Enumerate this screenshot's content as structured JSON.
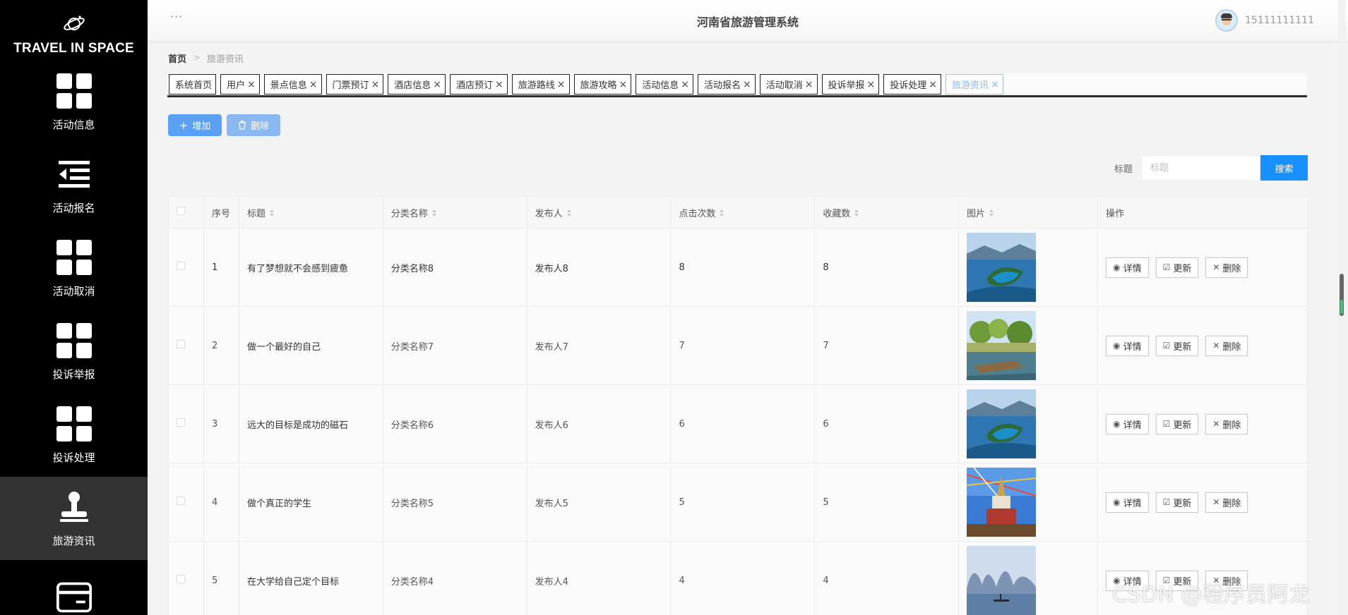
{
  "sidebar": {
    "brand": "TRAVEL IN SPACE",
    "items": [
      {
        "label": "活动信息",
        "icon": "grid-icon"
      },
      {
        "label": "活动报名",
        "icon": "list-indent-icon"
      },
      {
        "label": "活动取消",
        "icon": "grid-icon"
      },
      {
        "label": "投诉举报",
        "icon": "grid-icon"
      },
      {
        "label": "投诉处理",
        "icon": "grid-icon"
      },
      {
        "label": "旅游资讯",
        "icon": "stamp-icon",
        "active": true
      },
      {
        "label": "",
        "icon": "card-icon"
      }
    ]
  },
  "header": {
    "title": "河南省旅游管理系统",
    "username": "15111111111"
  },
  "breadcrumb": {
    "home": "首页",
    "separator": ">",
    "current": "旅游资讯"
  },
  "tabs": [
    {
      "label": "系统首页",
      "closable": false
    },
    {
      "label": "用户",
      "closable": true
    },
    {
      "label": "景点信息",
      "closable": true
    },
    {
      "label": "门票预订",
      "closable": true
    },
    {
      "label": "酒店信息",
      "closable": true
    },
    {
      "label": "酒店预订",
      "closable": true
    },
    {
      "label": "旅游路线",
      "closable": true
    },
    {
      "label": "旅游攻略",
      "closable": true
    },
    {
      "label": "活动信息",
      "closable": true
    },
    {
      "label": "活动报名",
      "closable": true
    },
    {
      "label": "活动取消",
      "closable": true
    },
    {
      "label": "投诉举报",
      "closable": true
    },
    {
      "label": "投诉处理",
      "closable": true
    },
    {
      "label": "旅游资讯",
      "closable": true,
      "active": true
    }
  ],
  "toolbar": {
    "add_label": "增加",
    "delete_label": "删除"
  },
  "search": {
    "label": "标题",
    "placeholder": "标题",
    "value": "",
    "button": "搜索"
  },
  "table": {
    "columns": [
      "序号",
      "标题",
      "分类名称",
      "发布人",
      "点击次数",
      "收藏数",
      "图片",
      "操作"
    ],
    "rows": [
      {
        "no": "1",
        "title": "有了梦想就不会感到疲惫",
        "category": "分类名称8",
        "publisher": "发布人8",
        "clicks": "8",
        "favorites": "8",
        "image": "lake-island"
      },
      {
        "no": "2",
        "title": "做一个最好的自己",
        "category": "分类名称7",
        "publisher": "发布人7",
        "clicks": "7",
        "favorites": "7",
        "image": "lakeside-trees"
      },
      {
        "no": "3",
        "title": "远大的目标是成功的磁石",
        "category": "分类名称6",
        "publisher": "发布人6",
        "clicks": "6",
        "favorites": "6",
        "image": "lake-island"
      },
      {
        "no": "4",
        "title": "做个真正的学生",
        "category": "分类名称5",
        "publisher": "发布人5",
        "clicks": "5",
        "favorites": "5",
        "image": "stupa-flags"
      },
      {
        "no": "5",
        "title": "在大学给自己定个目标",
        "category": "分类名称4",
        "publisher": "发布人4",
        "clicks": "4",
        "favorites": "4",
        "image": "karst-river"
      }
    ],
    "actions": {
      "detail": "详情",
      "update": "更新",
      "delete": "删除"
    }
  },
  "watermark": "CSDN @程序员阿龙",
  "colors": {
    "primary": "#1890ff",
    "button": "#5aa1f5",
    "sidebar": "#000000",
    "active_menu": "#333333"
  }
}
